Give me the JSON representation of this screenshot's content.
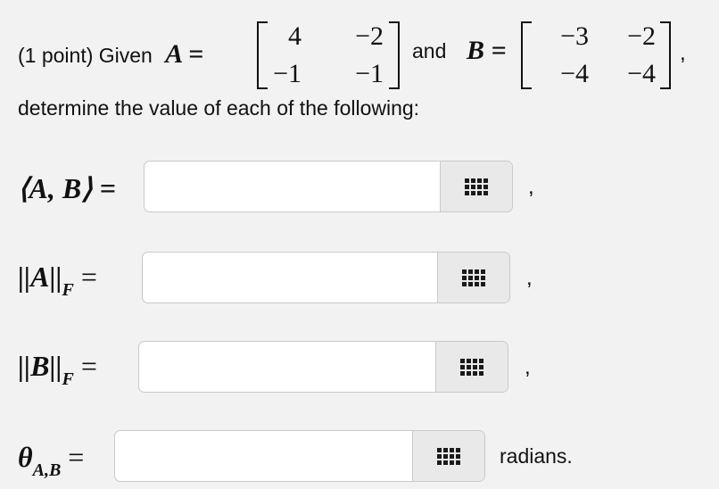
{
  "intro": {
    "prefix": "(1 point) Given",
    "A_eq": "A =",
    "and": "and",
    "B_eq": "B =",
    "trail": ",",
    "instruction": "determine the value of each of the following:"
  },
  "matrixA": [
    [
      "4",
      "−2"
    ],
    [
      "−1",
      "−1"
    ]
  ],
  "matrixB": [
    [
      "−3",
      "−2"
    ],
    [
      "−4",
      "−4"
    ]
  ],
  "questions": [
    {
      "label": "⟨A, B⟩ =",
      "value": "",
      "suffix": ","
    },
    {
      "label_main": "||A||",
      "label_sub": "F",
      "label_eq": " =",
      "value": "",
      "suffix": ","
    },
    {
      "label_main": "||B||",
      "label_sub": "F",
      "label_eq": " =",
      "value": "",
      "suffix": ","
    },
    {
      "label_main": "θ",
      "label_sub": "A,B",
      "label_eq": " =",
      "value": "",
      "suffix": "radians."
    }
  ],
  "keyboard_icon": "keypad-icon"
}
